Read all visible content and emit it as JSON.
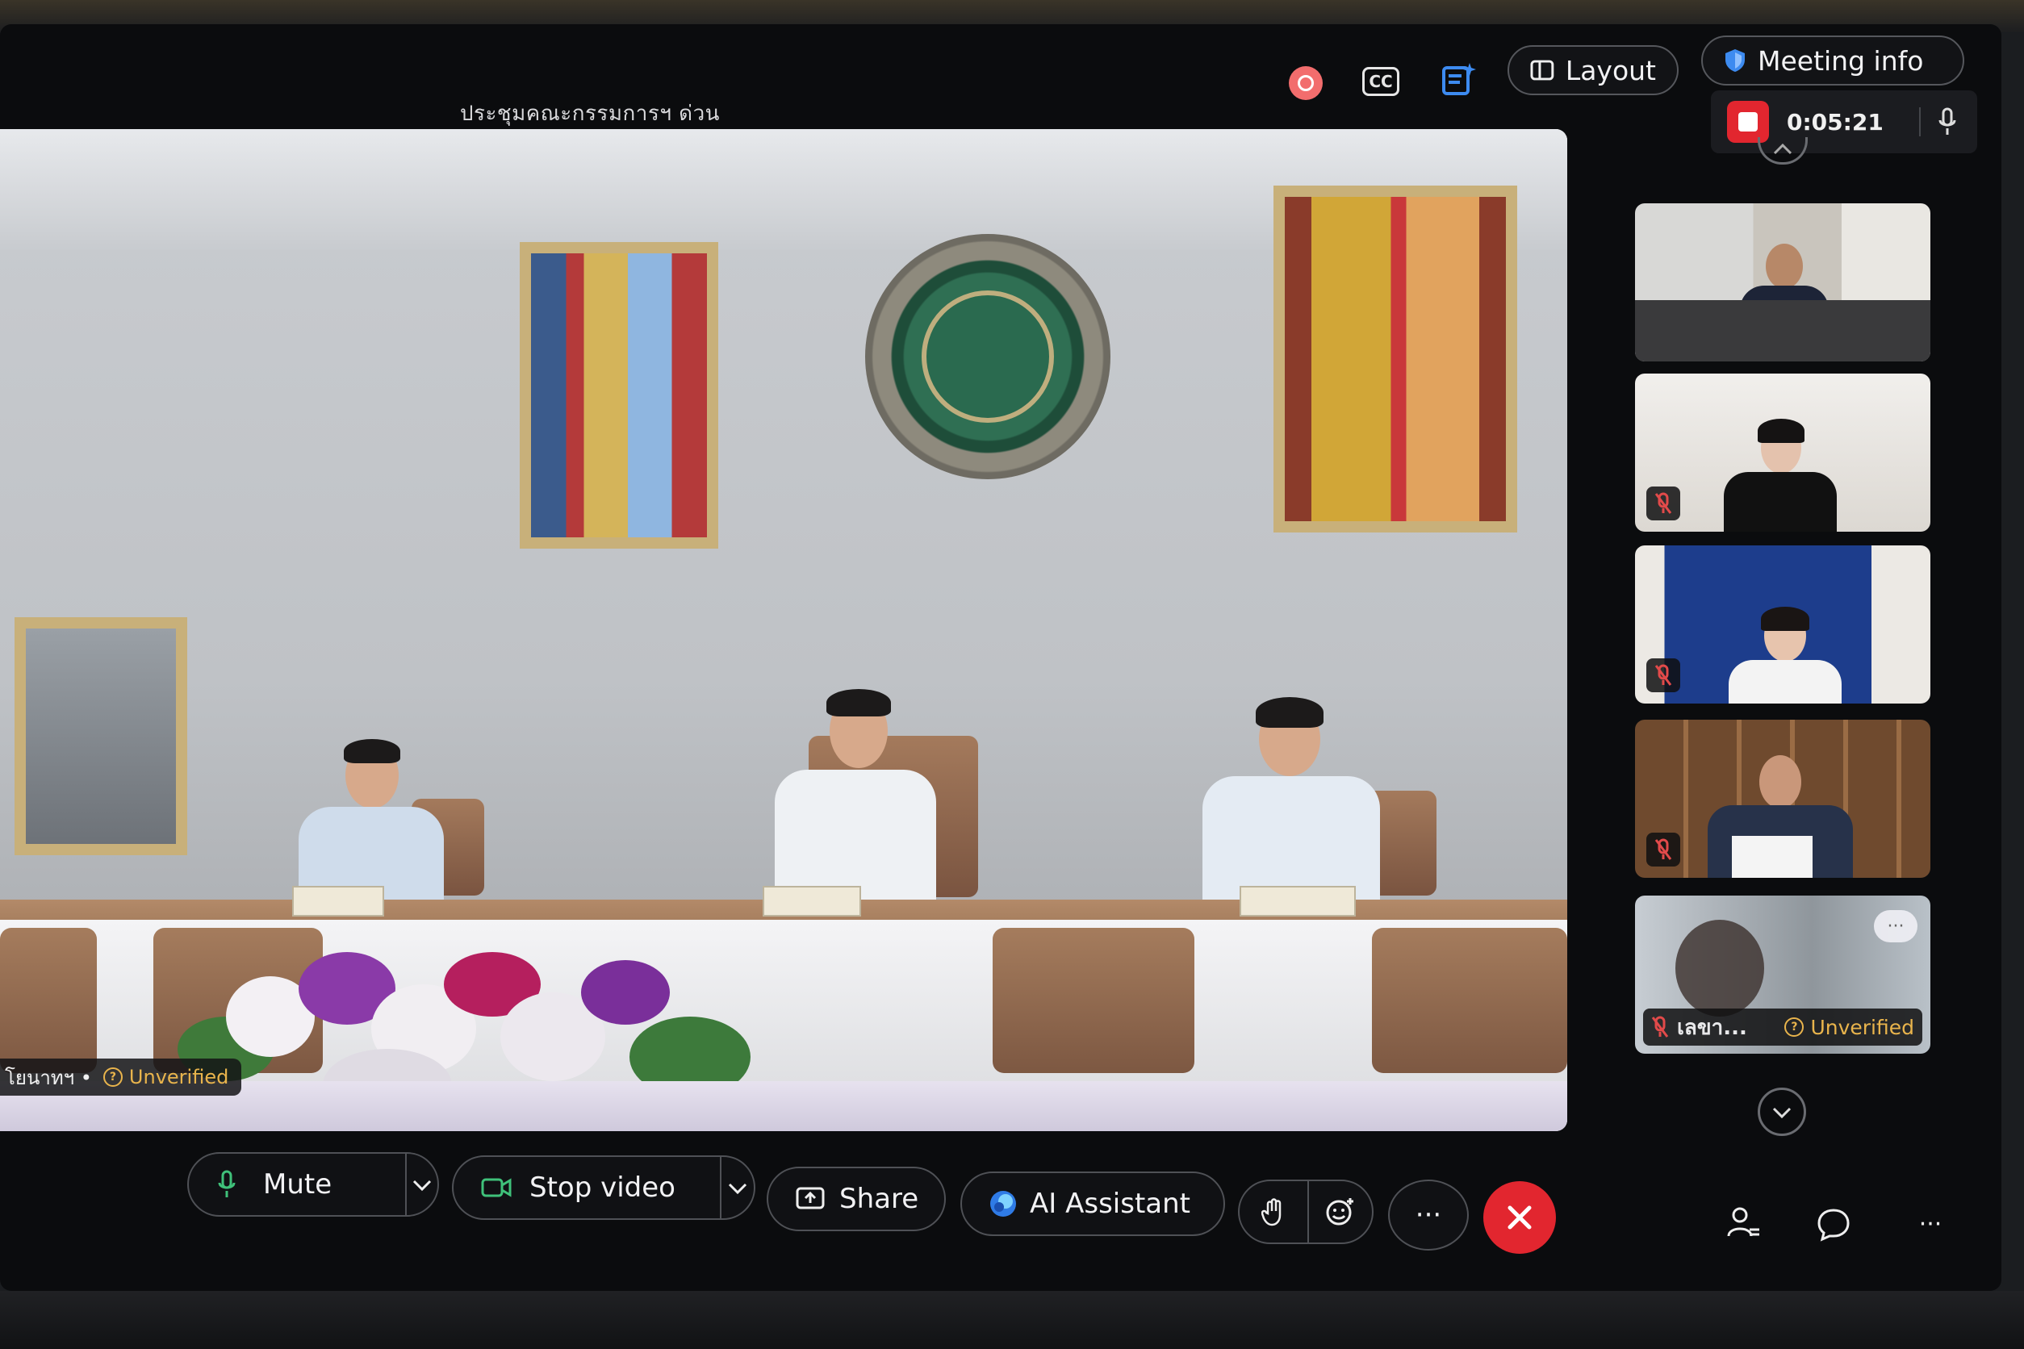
{
  "meeting": {
    "title": "ประชุมคณะกรรมการฯ ด่วน",
    "timer": "0:05:21"
  },
  "topbar": {
    "layout_label": "Layout",
    "meeting_info_label": "Meeting info",
    "cc_label": "CC"
  },
  "main_video": {
    "participant_name": "โยนาทฯ •",
    "status": "Unverified"
  },
  "thumbnails": [
    {
      "name": "",
      "muted": false
    },
    {
      "name": "",
      "muted": true
    },
    {
      "name": "",
      "muted": true
    },
    {
      "name": "",
      "muted": true
    },
    {
      "name": "เลขา...",
      "muted": true,
      "status": "Unverified",
      "more": "···"
    }
  ],
  "controls": {
    "mute_label": "Mute",
    "stop_video_label": "Stop video",
    "share_label": "Share",
    "ai_assistant_label": "AI Assistant",
    "more_label": "···",
    "sidebar_more_label": "···"
  },
  "colors": {
    "end_call": "#e2262f",
    "recording": "#e2262f",
    "unverified": "#e9b44c",
    "accent_blue": "#3d8bf0"
  }
}
